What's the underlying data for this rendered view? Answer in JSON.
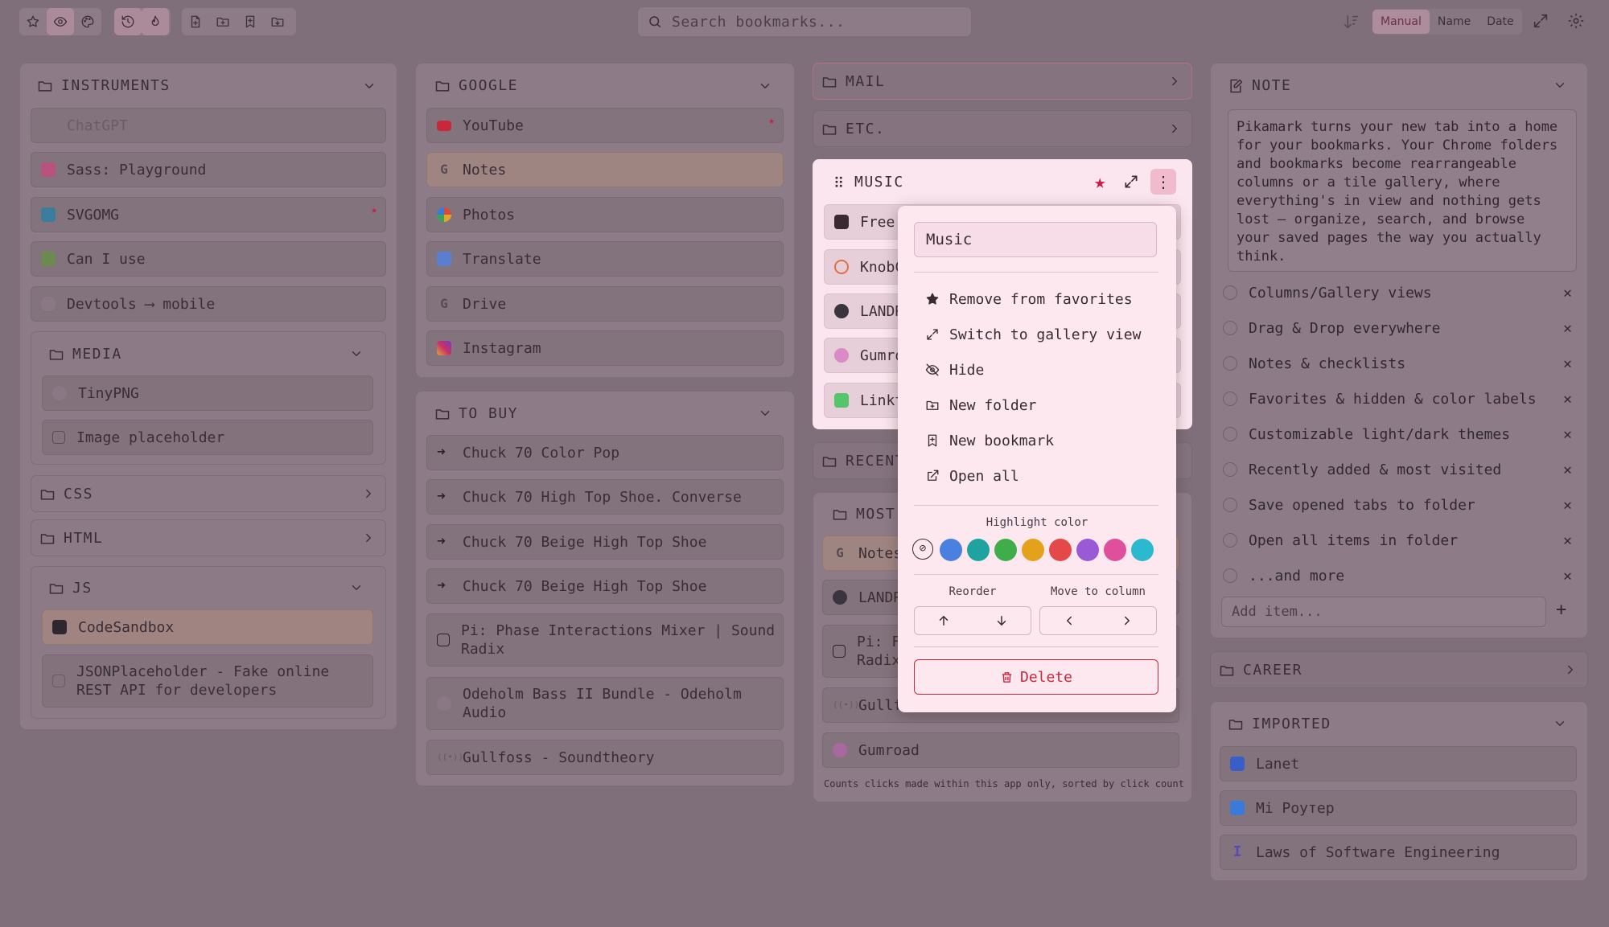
{
  "toolbar": {
    "search_placeholder": "Search bookmarks...",
    "sort_options": [
      "Manual",
      "Name",
      "Date"
    ],
    "sort_selected": "Manual"
  },
  "col1": {
    "instruments": {
      "title": "INSTRUMENTS",
      "items": [
        "ChatGPT",
        "Sass: Playground",
        "SVGOMG",
        "Can I use",
        "Devtools ⟶ mobile"
      ]
    },
    "media": {
      "title": "MEDIA",
      "items": [
        "TinyPNG",
        "Image placeholder"
      ]
    },
    "css": {
      "title": "CSS"
    },
    "html": {
      "title": "HTML"
    },
    "js": {
      "title": "JS",
      "items": [
        "CodeSandbox",
        "JSONPlaceholder - Fake online REST API for developers"
      ]
    }
  },
  "col2": {
    "google": {
      "title": "GOOGLE",
      "items": [
        "YouTube",
        "Notes",
        "Photos",
        "Translate",
        "Drive",
        "Instagram"
      ]
    },
    "to_buy": {
      "title": "TO BUY",
      "items": [
        "Chuck 70 Color Pop",
        "Chuck 70 High Top Shoe. Converse",
        "Chuck 70 Beige High Top Shoe",
        "Chuck 70 Beige High Top Shoe",
        "Pi: Phase Interactions Mixer | Sound Radix",
        "Odeholm Bass II Bundle - Odeholm Audio",
        "Gullfoss - Soundtheory"
      ]
    }
  },
  "col3": {
    "mail": {
      "title": "MAIL"
    },
    "etc": {
      "title": "ETC."
    },
    "music": {
      "title": "MUSIC",
      "items": [
        "Free",
        "KnobC",
        "LANDR",
        "Gumro",
        "Linkt"
      ]
    },
    "recent": {
      "title": "RECENT"
    },
    "most": {
      "title": "MOST",
      "items": [
        "Notes",
        "LANDR",
        "Pi: F",
        "Radix",
        "Gullf",
        "Gumroad"
      ],
      "footnote": "Counts clicks made within this app only, sorted by click count"
    }
  },
  "menu": {
    "input_value": "Music",
    "items": [
      "Remove from favorites",
      "Switch to gallery view",
      "Hide",
      "New folder",
      "New bookmark",
      "Open all"
    ],
    "highlight_label": "Highlight color",
    "colors": [
      "#4a80e0",
      "#1ea3a0",
      "#3fae4a",
      "#e4a21c",
      "#e54848",
      "#9a5ad6",
      "#df4f9c",
      "#2bb9cf"
    ],
    "reorder_label": "Reorder",
    "move_label": "Move to column",
    "delete_label": "Delete"
  },
  "col4": {
    "note": {
      "title": "NOTE",
      "text": "Pikamark turns your new tab into a home\nfor your bookmarks. Your Chrome folders\nand bookmarks become rearrangeable\ncolumns or a tile gallery, where\neverything's in view and nothing gets\nlost — organize, search, and browse\nyour saved pages the way you actually\nthink.",
      "checklist": [
        "Columns/Gallery views",
        "Drag & Drop everywhere",
        "Notes & checklists",
        "Favorites & hidden & color labels",
        "Customizable light/dark themes",
        "Recently added & most visited",
        "Save opened tabs to folder",
        "Open all items in folder",
        "...and more"
      ],
      "add_placeholder": "Add item..."
    },
    "career": {
      "title": "CAREER"
    },
    "imported": {
      "title": "IMPORTED",
      "items": [
        "Lanet",
        "Mi Роутер",
        "Laws of Software Engineering"
      ]
    }
  }
}
